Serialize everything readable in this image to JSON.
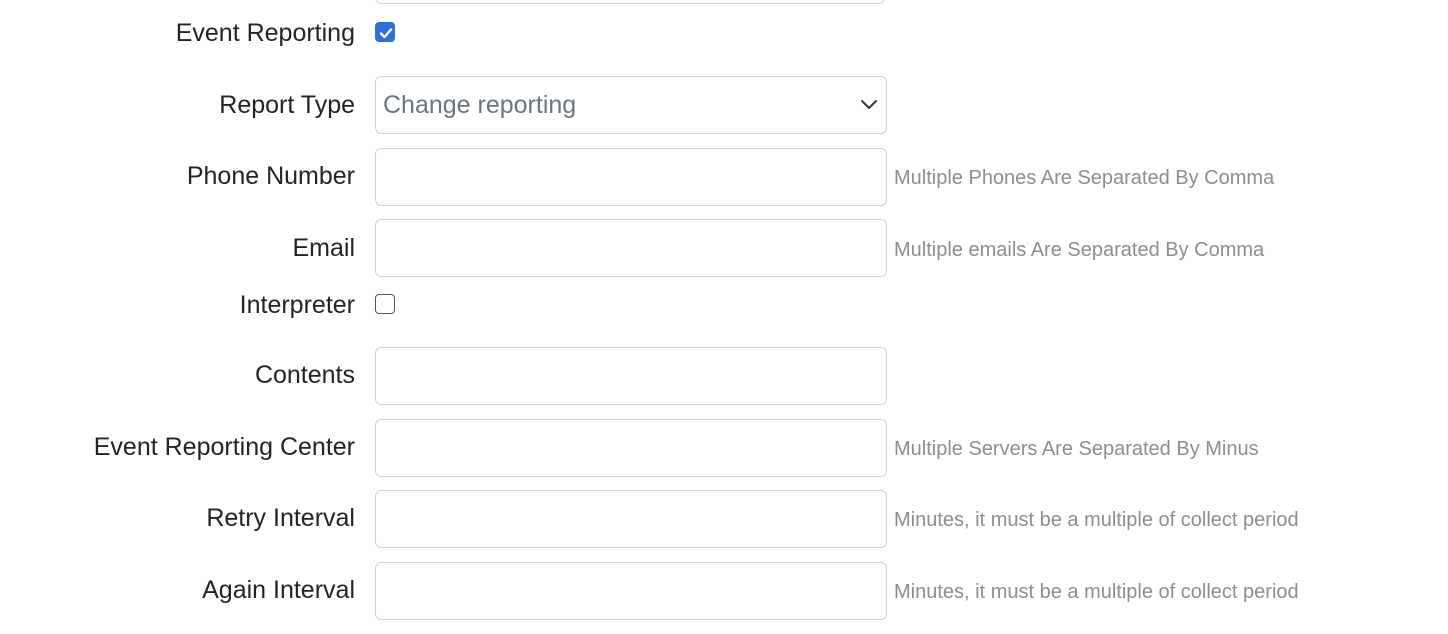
{
  "form": {
    "event_reporting": {
      "label": "Event Reporting",
      "checked": true
    },
    "report_type": {
      "label": "Report Type",
      "selected": "Change reporting"
    },
    "phone_number": {
      "label": "Phone Number",
      "value": "",
      "hint": "Multiple Phones Are Separated By Comma"
    },
    "email": {
      "label": "Email",
      "value": "",
      "hint": "Multiple emails Are Separated By Comma"
    },
    "interpreter": {
      "label": "Interpreter",
      "checked": false
    },
    "contents": {
      "label": "Contents",
      "value": ""
    },
    "event_reporting_center": {
      "label": "Event Reporting Center",
      "value": "",
      "hint": "Multiple Servers Are Separated By Minus"
    },
    "retry_interval": {
      "label": "Retry Interval",
      "value": "",
      "hint": "Minutes, it must be a multiple of collect period"
    },
    "again_interval": {
      "label": "Again Interval",
      "value": "",
      "hint": "Minutes, it must be a multiple of collect period"
    }
  },
  "colors": {
    "checkbox_checked": "#2f6fdb",
    "border": "#ced4da",
    "label_text": "#212529",
    "hint_text": "#8a8f94",
    "placeholder_text": "#6c757d"
  }
}
